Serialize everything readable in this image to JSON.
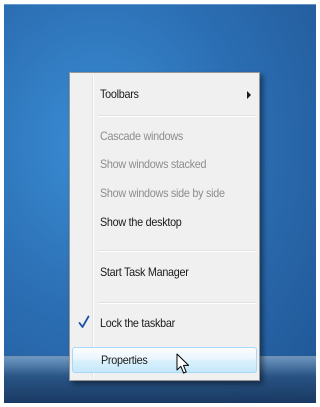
{
  "menu": {
    "items": [
      {
        "label": "Toolbars",
        "enabled": true,
        "submenu": true
      },
      {
        "label": "Cascade windows",
        "enabled": false
      },
      {
        "label": "Show windows stacked",
        "enabled": false
      },
      {
        "label": "Show windows side by side",
        "enabled": false
      },
      {
        "label": "Show the desktop",
        "enabled": true
      },
      {
        "label": "Start Task Manager",
        "enabled": true
      },
      {
        "label": "Lock the taskbar",
        "enabled": true,
        "checked": true
      },
      {
        "label": "Properties",
        "enabled": true,
        "hovered": true
      }
    ]
  },
  "colors": {
    "desktop": "#2c6fb4",
    "menu_bg": "#f0f0f0",
    "disabled_text": "#8d8d8d",
    "check": "#1f4fa8",
    "highlight": "#d9f0fc"
  },
  "icons": {
    "submenu": "chevron-right-icon",
    "check": "checkmark-icon",
    "cursor": "mouse-pointer-icon"
  }
}
